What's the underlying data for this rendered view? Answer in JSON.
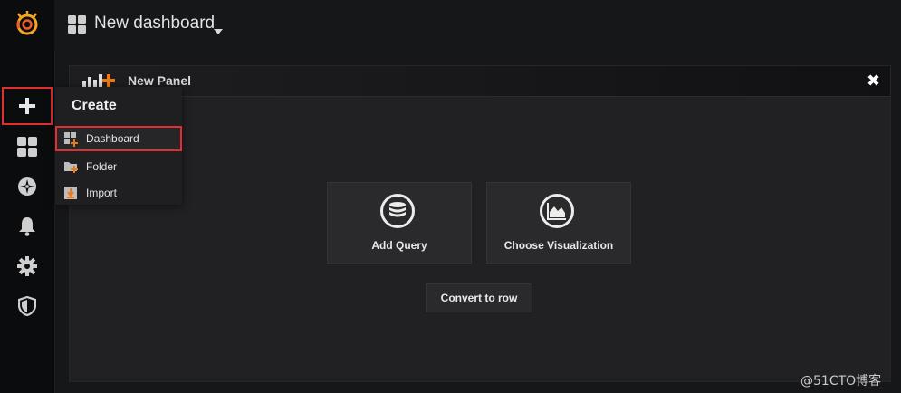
{
  "header": {
    "title": "New dashboard",
    "title_icon": "grid-icon",
    "caret_icon": "caret-down-icon"
  },
  "sidebar": {
    "logo": "grafana-logo",
    "items": [
      {
        "name": "create",
        "icon": "plus-icon"
      },
      {
        "name": "dashboards",
        "icon": "dashboards-grid-icon"
      },
      {
        "name": "explore",
        "icon": "compass-icon"
      },
      {
        "name": "alerting",
        "icon": "bell-icon"
      },
      {
        "name": "configuration",
        "icon": "gear-icon"
      },
      {
        "name": "server-admin",
        "icon": "shield-icon"
      }
    ]
  },
  "create_menu": {
    "header": "Create",
    "items": [
      {
        "label": "Dashboard",
        "icon": "dashboard-add-icon",
        "highlighted": true
      },
      {
        "label": "Folder",
        "icon": "folder-add-icon"
      },
      {
        "label": "Import",
        "icon": "import-icon"
      }
    ]
  },
  "panel": {
    "title": "New Panel",
    "close_label": "✖",
    "actions": [
      {
        "label": "Add Query",
        "icon": "database-icon"
      },
      {
        "label": "Choose Visualization",
        "icon": "chart-area-icon"
      }
    ],
    "convert_label": "Convert to row"
  },
  "watermark": "@51CTO博客",
  "colors": {
    "accent": "#eb7b18",
    "highlight_border": "#e02f2f",
    "background": "#161719",
    "sidebar": "#0b0c0e",
    "panel": "#212124"
  }
}
